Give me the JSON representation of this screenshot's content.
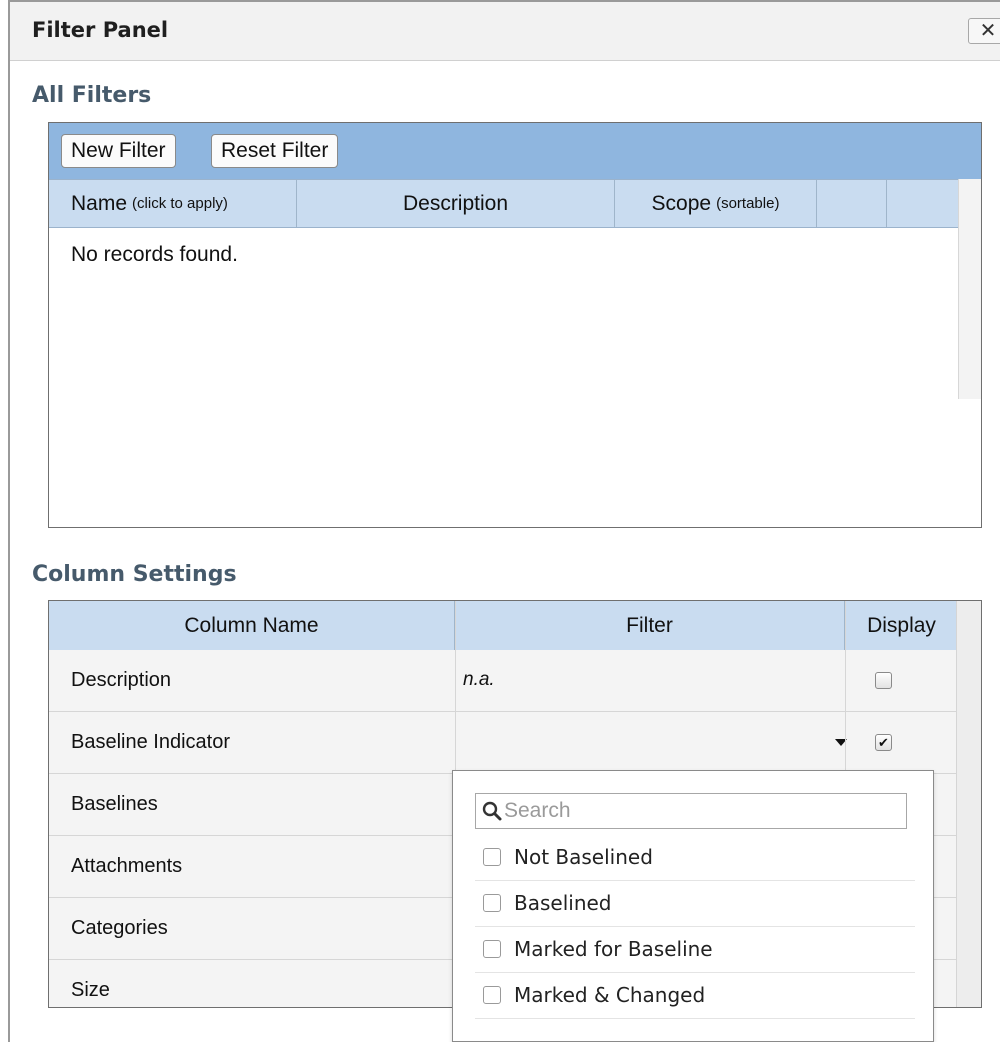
{
  "panel": {
    "title": "Filter Panel",
    "close_label": "✕"
  },
  "all_filters": {
    "heading": "All Filters",
    "toolbar": {
      "new_filter": "New Filter",
      "reset_filter": "Reset Filter"
    },
    "columns": [
      {
        "label": "Name",
        "note": "(click to apply)"
      },
      {
        "label": "Description",
        "note": ""
      },
      {
        "label": "Scope",
        "note": "(sortable)"
      },
      {
        "label": "",
        "note": ""
      },
      {
        "label": "",
        "note": ""
      }
    ],
    "empty_message": "No records found."
  },
  "column_settings": {
    "heading": "Column Settings",
    "headers": {
      "name": "Column Name",
      "filter": "Filter",
      "display": "Display"
    },
    "rows": [
      {
        "name": "Description",
        "filter": "n.a.",
        "display": "unchecked"
      },
      {
        "name": "Baseline Indicator",
        "filter": "",
        "display": "checked"
      },
      {
        "name": "Baselines",
        "filter": "",
        "display": ""
      },
      {
        "name": "Attachments",
        "filter": "",
        "display": ""
      },
      {
        "name": "Categories",
        "filter": "",
        "display": ""
      },
      {
        "name": "Size",
        "filter": "",
        "display": ""
      }
    ]
  },
  "baseline_dropdown": {
    "search_placeholder": "Search",
    "search_value": "",
    "icon": "search-icon",
    "options": [
      {
        "label": "Not Baselined",
        "checked": false
      },
      {
        "label": "Baselined",
        "checked": false
      },
      {
        "label": "Marked for Baseline",
        "checked": false
      },
      {
        "label": "Marked & Changed",
        "checked": false
      }
    ]
  },
  "colors": {
    "toolbar_bg": "#8fb6df",
    "header_bg": "#c9dcf0",
    "section_heading": "#465a6b"
  }
}
